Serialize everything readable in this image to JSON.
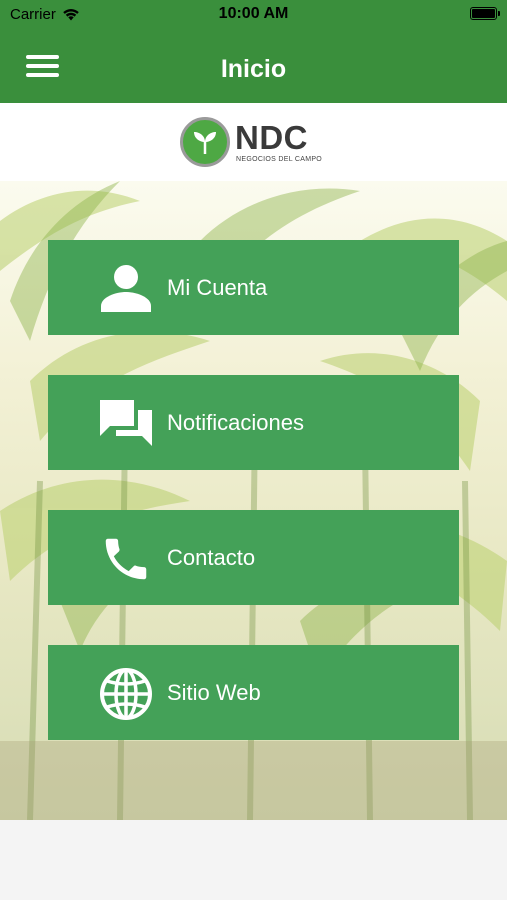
{
  "status_bar": {
    "carrier": "Carrier",
    "time": "10:00 AM"
  },
  "header": {
    "title": "Inicio"
  },
  "logo": {
    "name": "NDC",
    "tagline": "NEGOCIOS DEL CAMPO"
  },
  "menu": [
    {
      "label": "Mi Cuenta",
      "icon": "person-icon"
    },
    {
      "label": "Notificaciones",
      "icon": "chat-icon"
    },
    {
      "label": "Contacto",
      "icon": "phone-icon"
    },
    {
      "label": "Sitio Web",
      "icon": "globe-icon"
    }
  ],
  "colors": {
    "primary": "#3a8f3c",
    "button": "#44a158"
  }
}
